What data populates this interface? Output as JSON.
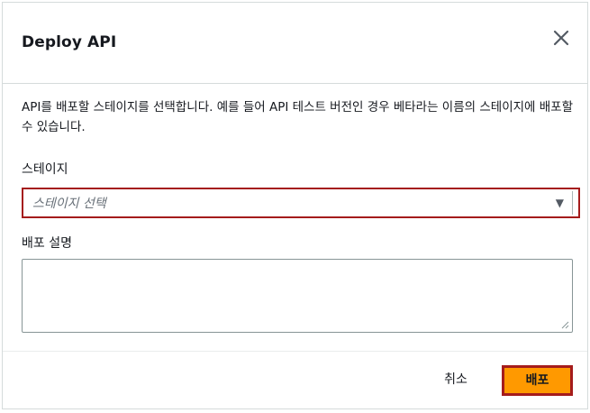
{
  "modal": {
    "title": "Deploy API",
    "close_icon": "close-icon"
  },
  "body": {
    "description": "API를 배포할 스테이지를 선택합니다. 예를 들어 API 테스트 버전인 경우 베타라는 이름의 스테이지에 배포할 수 있습니다.",
    "stage_label": "스테이지",
    "stage_placeholder": "스테이지 선택",
    "stage_caret_icon": "caret-down-icon",
    "deploy_description_label": "배포 설명",
    "deploy_description_value": ""
  },
  "footer": {
    "cancel_label": "취소",
    "deploy_label": "배포"
  },
  "colors": {
    "primary_button": "#ff9900",
    "highlight_border": "#a51c1c"
  }
}
